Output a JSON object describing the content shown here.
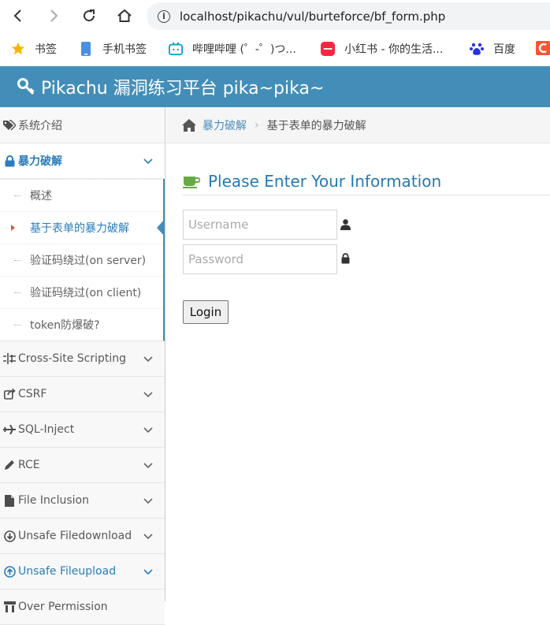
{
  "browser": {
    "url": "localhost/pikachu/vul/burteforce/bf_form.php",
    "bookmarks": [
      {
        "label": "书签",
        "icon": "star-icon"
      },
      {
        "label": "手机书签",
        "icon": "phone-icon"
      },
      {
        "label": "哔哩哔哩 (゜-゜)つ...",
        "icon": "bilibili-icon"
      },
      {
        "label": "小红书 - 你的生活...",
        "icon": "xiaohongshu-icon"
      },
      {
        "label": "百度",
        "icon": "baidu-paw-icon"
      }
    ]
  },
  "header": {
    "title": "Pikachu 漏洞练习平台 pika~pika~"
  },
  "sidebar": {
    "items": [
      {
        "label": "系统介绍",
        "icon": "tags-icon"
      },
      {
        "label": "暴力破解",
        "icon": "lock-icon",
        "open": true,
        "children": [
          "概述",
          "基于表单的暴力破解",
          "验证码绕过(on server)",
          "验证码绕过(on client)",
          "token防爆破?"
        ]
      },
      {
        "label": "Cross-Site Scripting",
        "icon": "xss-icon"
      },
      {
        "label": "CSRF",
        "icon": "share-icon"
      },
      {
        "label": "SQL-Inject",
        "icon": "plane-icon"
      },
      {
        "label": "RCE",
        "icon": "pencil-icon"
      },
      {
        "label": "File Inclusion",
        "icon": "file-icon"
      },
      {
        "label": "Unsafe Filedownload",
        "icon": "download-icon"
      },
      {
        "label": "Unsafe Fileupload",
        "icon": "upload-icon"
      },
      {
        "label": "Over Permission",
        "icon": "permission-icon"
      }
    ]
  },
  "breadcrumb": {
    "link": "暴力破解",
    "separator": "›",
    "current": "基于表单的暴力破解"
  },
  "form": {
    "title": "Please Enter Your Information",
    "username_placeholder": "Username",
    "password_placeholder": "Password",
    "login_label": "Login"
  },
  "colors": {
    "header_bg": "#438eb9",
    "accent": "#2b7dbc",
    "title_blue": "#2679b5"
  }
}
